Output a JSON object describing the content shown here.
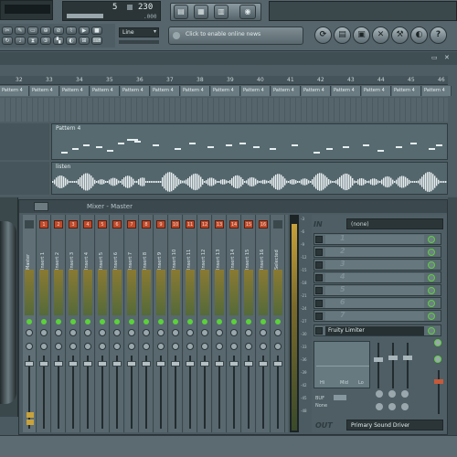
{
  "toolbar": {
    "pattern_number": "5",
    "tempo": "230",
    "tempo_sub": ".000",
    "snap_mode": "Line",
    "news_placeholder": "Click to enable online news"
  },
  "playlist": {
    "bar_numbers": [
      "32",
      "33",
      "34",
      "35",
      "36",
      "37",
      "38",
      "39",
      "40",
      "41",
      "42",
      "43",
      "44",
      "45",
      "46"
    ],
    "pattern_clip_label": "Pattern 4",
    "audio_clip_label": "listen"
  },
  "mixer": {
    "title": "Mixer - Master",
    "channel_numbers": [
      "1",
      "2",
      "3",
      "4",
      "5",
      "6",
      "7",
      "8",
      "9",
      "10",
      "11",
      "12",
      "13",
      "14",
      "15",
      "16"
    ],
    "insert_labels": [
      "Master",
      "Insert 1",
      "Insert 2",
      "Insert 3",
      "Insert 4",
      "Insert 5",
      "Insert 6",
      "Insert 7",
      "Insert 8",
      "Insert 9",
      "Insert 10",
      "Insert 11",
      "Insert 12",
      "Insert 13",
      "Insert 14",
      "Insert 15",
      "Insert 16",
      "Selected"
    ],
    "meter_scale": [
      "-3",
      "-6",
      "-9",
      "-12",
      "-15",
      "-18",
      "-21",
      "-24",
      "-27",
      "-30",
      "-33",
      "-36",
      "-39",
      "-42",
      "-45",
      "-48"
    ],
    "preset_value": "(none)",
    "effect_slots": [
      "1",
      "2",
      "3",
      "4",
      "5",
      "6",
      "7"
    ],
    "slot8_effect": "Fruity Limiter",
    "eq_labels": [
      "Hi",
      "Mid",
      "Lo"
    ],
    "buffer_label": "BUF",
    "buffer_value": "None",
    "output_label": "OUT",
    "output_device": "Primary Sound Driver",
    "input_label": "IN"
  },
  "colors": {
    "background": "#4a5a60",
    "vu_green": "#5bd13a",
    "level_amber": "#c8a23a",
    "waveform": "#e8eef0"
  }
}
